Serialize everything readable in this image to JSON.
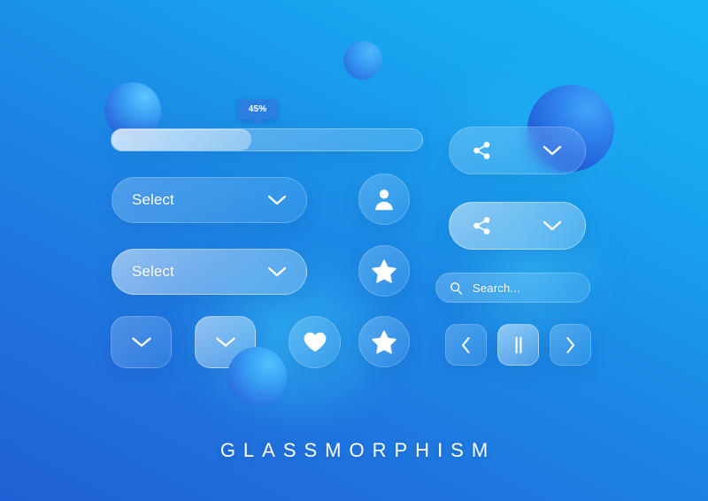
{
  "page": {
    "title": "GLASSMORPHISM",
    "background": {
      "gradient_from": "#16b4f7",
      "gradient_to": "#2160d6",
      "accent_glow": "#3cd7ff"
    }
  },
  "progress": {
    "value": 45,
    "badge_label": "45%",
    "badge_color": "#2b7fe0",
    "track_name": "progress-track"
  },
  "selects": [
    {
      "label": "Select",
      "chevron": "chevron-down-icon"
    },
    {
      "label": "Select",
      "chevron": "chevron-down-icon"
    }
  ],
  "share_pills": [
    {
      "left_icon": "share-icon",
      "right_icon": "chevron-down-icon"
    },
    {
      "left_icon": "share-icon",
      "right_icon": "chevron-down-icon"
    }
  ],
  "search": {
    "icon": "search-icon",
    "placeholder": "Search...",
    "value": ""
  },
  "circle_buttons": [
    {
      "icon": "person-icon"
    },
    {
      "icon": "star-icon"
    },
    {
      "icon": "heart-icon"
    },
    {
      "icon": "star-icon"
    }
  ],
  "square_buttons": [
    {
      "icon": "chevron-down-icon"
    },
    {
      "icon": "chevron-down-icon"
    }
  ],
  "media_controls": [
    {
      "icon": "chevron-left-icon",
      "action": "previous"
    },
    {
      "icon": "pause-icon",
      "action": "pause"
    },
    {
      "icon": "chevron-right-icon",
      "action": "next"
    }
  ],
  "spheres": [
    {
      "name": "sphere-top-left"
    },
    {
      "name": "sphere-top-center"
    },
    {
      "name": "sphere-top-right"
    },
    {
      "name": "sphere-bottom-center"
    }
  ]
}
